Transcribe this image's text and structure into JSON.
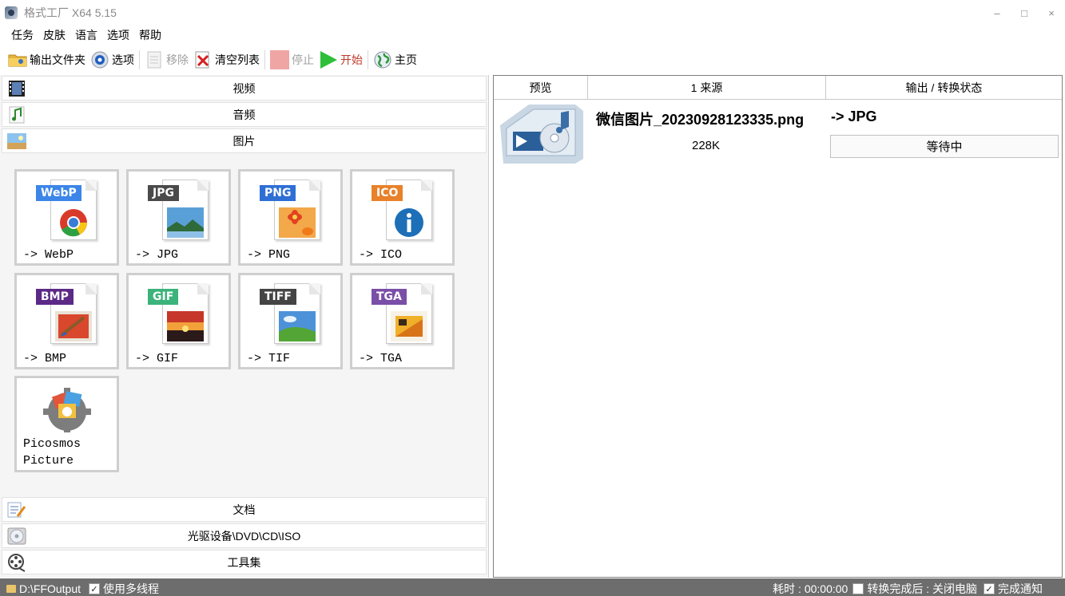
{
  "window": {
    "title": "格式工厂 X64 5.15",
    "controls": {
      "minimize": "–",
      "maximize": "□",
      "close": "×"
    }
  },
  "menu": [
    "任务",
    "皮肤",
    "语言",
    "选项",
    "帮助"
  ],
  "toolbar": {
    "output_folder": "输出文件夹",
    "options": "选项",
    "remove": "移除",
    "clear_list": "清空列表",
    "stop": "停止",
    "start": "开始",
    "home": "主页"
  },
  "categories": {
    "video": "视频",
    "audio": "音频",
    "image": "图片",
    "document": "文档",
    "optical": "光驱设备\\DVD\\CD\\ISO",
    "tools": "工具集"
  },
  "image_tools": [
    {
      "badge": "WebP",
      "label": "-> WebP",
      "color": "#3b86e8"
    },
    {
      "badge": "JPG",
      "label": "-> JPG",
      "color": "#4a4a4a"
    },
    {
      "badge": "PNG",
      "label": "-> PNG",
      "color": "#2e6fd6"
    },
    {
      "badge": "ICO",
      "label": "-> ICO",
      "color": "#e8812a"
    },
    {
      "badge": "BMP",
      "label": "-> BMP",
      "color": "#5c2a86"
    },
    {
      "badge": "GIF",
      "label": "-> GIF",
      "color": "#3bb37a"
    },
    {
      "badge": "TIFF",
      "label": "-> TIF",
      "color": "#444444"
    },
    {
      "badge": "TGA",
      "label": "-> TGA",
      "color": "#7b4ea8"
    }
  ],
  "picosmos": {
    "line1": "Picosmos",
    "line2": "Picture"
  },
  "task_table": {
    "columns": [
      "预览",
      "1 来源",
      "输出 / 转换状态"
    ],
    "rows": [
      {
        "filename": "微信图片_20230928123335.png",
        "target": "-> JPG",
        "size": "228K",
        "status": "等待中"
      }
    ]
  },
  "statusbar": {
    "output_path": "D:\\FFOutput",
    "multithread": "使用多线程",
    "elapsed": "耗时 : 00:00:00",
    "after_done": "转换完成后 : 关闭电脑",
    "notify": "完成通知"
  }
}
